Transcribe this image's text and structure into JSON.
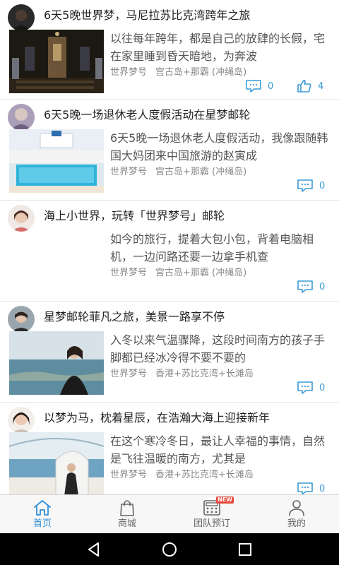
{
  "posts": [
    {
      "title": "6天5晚世界梦，马尼拉苏比克湾跨年之旅",
      "excerpt": "以往每年跨年，都是自己的放肆的长假，宅在家里睡到昏天暗地，为奔波",
      "ship": "世界梦号",
      "route": "宫古岛+那霸 (冲绳岛)",
      "comments": "0",
      "likes": "4"
    },
    {
      "title": "6天5晚一场退休老人度假活动在星梦邮轮",
      "excerpt": "6天5晚一场退休老人度假活动，我像跟随韩国大妈团来中国旅游的赵寅成",
      "ship": "世界梦号",
      "route": "宫古岛+那霸 (冲绳岛)",
      "comments": "0"
    },
    {
      "title": "海上小世界，玩转「世界梦号」邮轮",
      "excerpt": "如今的旅行，提着大包小包，背着电脑相机，一边问路还要一边拿手机查",
      "ship": "世界梦号",
      "route": "宫古岛+那霸 (冲绳岛)",
      "comments": "0"
    },
    {
      "title": "星梦邮轮菲凡之旅，美景一路享不停",
      "excerpt": "入冬以来气温骤降，这段时间南方的孩子手脚都已经冰冷得不要不要的",
      "ship": "世界梦号",
      "route": "香港+苏比克湾+长滩岛",
      "comments": "0"
    },
    {
      "title": "以梦为马，枕着星辰，在浩瀚大海上迎接新年",
      "excerpt": "在这个寒冷冬日，最让人幸福的事情，自然是飞往温暖的南方，尤其是",
      "ship": "世界梦号",
      "route": "香港+苏比克湾+长滩岛",
      "comments": "0"
    }
  ],
  "tabbar": {
    "home": "首页",
    "mall": "商城",
    "group": "团队预订",
    "mine": "我的",
    "badge": "NEW"
  },
  "colors": {
    "accent": "#2f8fd8",
    "icon": "#3a9bd6",
    "badge": "#e8483c"
  }
}
